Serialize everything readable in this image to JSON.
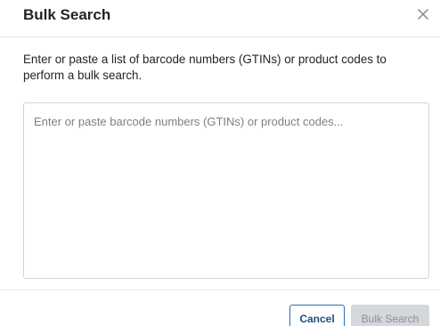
{
  "dialog": {
    "title": "Bulk Search",
    "close_icon": "close-icon",
    "instructions": "Enter or paste a list of barcode numbers (GTINs) or product codes to perform a bulk search.",
    "textarea": {
      "placeholder": "Enter or paste barcode numbers (GTINs) or product codes...",
      "value": ""
    },
    "buttons": {
      "cancel_label": "Cancel",
      "search_label": "Bulk Search",
      "search_disabled": true
    }
  },
  "colors": {
    "primary": "#2c6fb3",
    "primary_text": "#1d4f86",
    "disabled_bg": "#d4d7db",
    "disabled_text": "#8a8f95",
    "divider": "#e6e6e6"
  }
}
